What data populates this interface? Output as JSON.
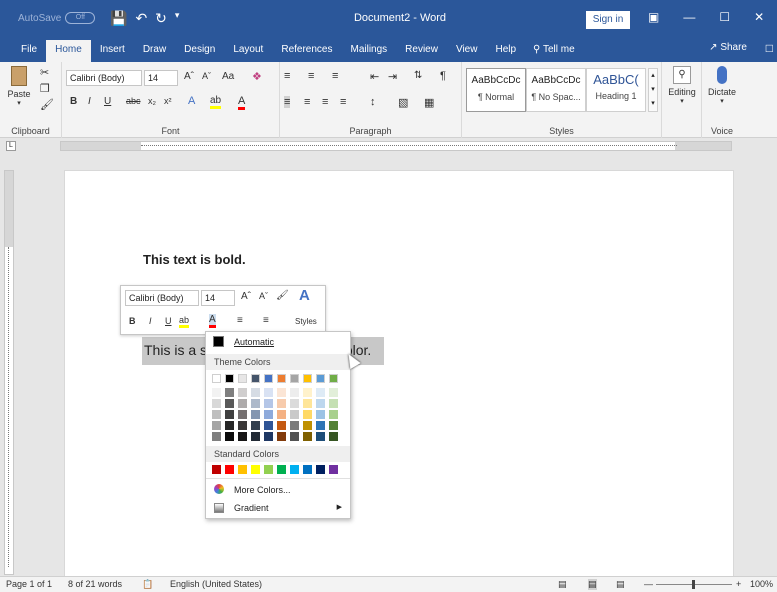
{
  "titlebar": {
    "autosave_label": "AutoSave",
    "autosave_state": "Off",
    "title": "Document2 - Word",
    "signin": "Sign in"
  },
  "tabs": [
    "File",
    "Home",
    "Insert",
    "Draw",
    "Design",
    "Layout",
    "References",
    "Mailings",
    "Review",
    "View",
    "Help"
  ],
  "tell_me": "Tell me",
  "share": "Share",
  "ribbon": {
    "clipboard": {
      "label": "Clipboard",
      "paste": "Paste"
    },
    "font": {
      "label": "Font",
      "font_name": "Calibri (Body)",
      "font_size": "14",
      "aa": "Aa"
    },
    "paragraph": {
      "label": "Paragraph"
    },
    "styles": {
      "label": "Styles",
      "items": [
        {
          "sample": "AaBbCcDc",
          "name": "¶ Normal"
        },
        {
          "sample": "AaBbCcDc",
          "name": "¶ No Spac..."
        },
        {
          "sample": "AaBbC(",
          "name": "Heading 1"
        }
      ]
    },
    "editing": {
      "label": "Editing"
    },
    "voice": {
      "label": "Voice",
      "dictate": "Dictate"
    }
  },
  "document": {
    "bold_text": "This text is bold.",
    "selected_text_start": "This is a se",
    "selected_text_end": "olor."
  },
  "mini_toolbar": {
    "font_name": "Calibri (Body)",
    "font_size": "14",
    "styles_label": "Styles"
  },
  "color_menu": {
    "automatic": "Automatic",
    "theme_colors": "Theme Colors",
    "standard_colors": "Standard Colors",
    "more_colors": "More Colors...",
    "gradient": "Gradient",
    "theme_top": [
      "#ffffff",
      "#000000",
      "#e7e6e6",
      "#44546a",
      "#4472c4",
      "#ed7d31",
      "#a5a5a5",
      "#ffc000",
      "#5b9bd5",
      "#70ad47"
    ],
    "theme_shades": [
      [
        "#f2f2f2",
        "#7f7f7f",
        "#d0cece",
        "#d6dce4",
        "#d9e2f3",
        "#fbe5d5",
        "#ededed",
        "#fff2cc",
        "#deebf6",
        "#e2efd9"
      ],
      [
        "#d8d8d8",
        "#595959",
        "#aeabab",
        "#adb9ca",
        "#b4c6e7",
        "#f7cbac",
        "#dbdbdb",
        "#fee599",
        "#bdd7ee",
        "#c5e0b3"
      ],
      [
        "#bfbfbf",
        "#3f3f3f",
        "#757070",
        "#8496b0",
        "#8eaadb",
        "#f4b183",
        "#c9c9c9",
        "#ffd965",
        "#9cc3e5",
        "#a8d08d"
      ],
      [
        "#a5a5a5",
        "#262626",
        "#3a3838",
        "#323f4f",
        "#2f5496",
        "#c45911",
        "#7b7b7b",
        "#bf9000",
        "#2e75b5",
        "#538135"
      ],
      [
        "#7f7f7f",
        "#0c0c0c",
        "#171616",
        "#222a35",
        "#1f3864",
        "#823b0b",
        "#525252",
        "#7f6000",
        "#1e4e79",
        "#375623"
      ]
    ],
    "standard": [
      "#c00000",
      "#ff0000",
      "#ffc000",
      "#ffff00",
      "#92d050",
      "#00b050",
      "#00b0f0",
      "#0070c0",
      "#002060",
      "#7030a0"
    ]
  },
  "statusbar": {
    "page": "Page 1 of 1",
    "words": "8 of 21 words",
    "language": "English (United States)",
    "zoom": "100%"
  }
}
